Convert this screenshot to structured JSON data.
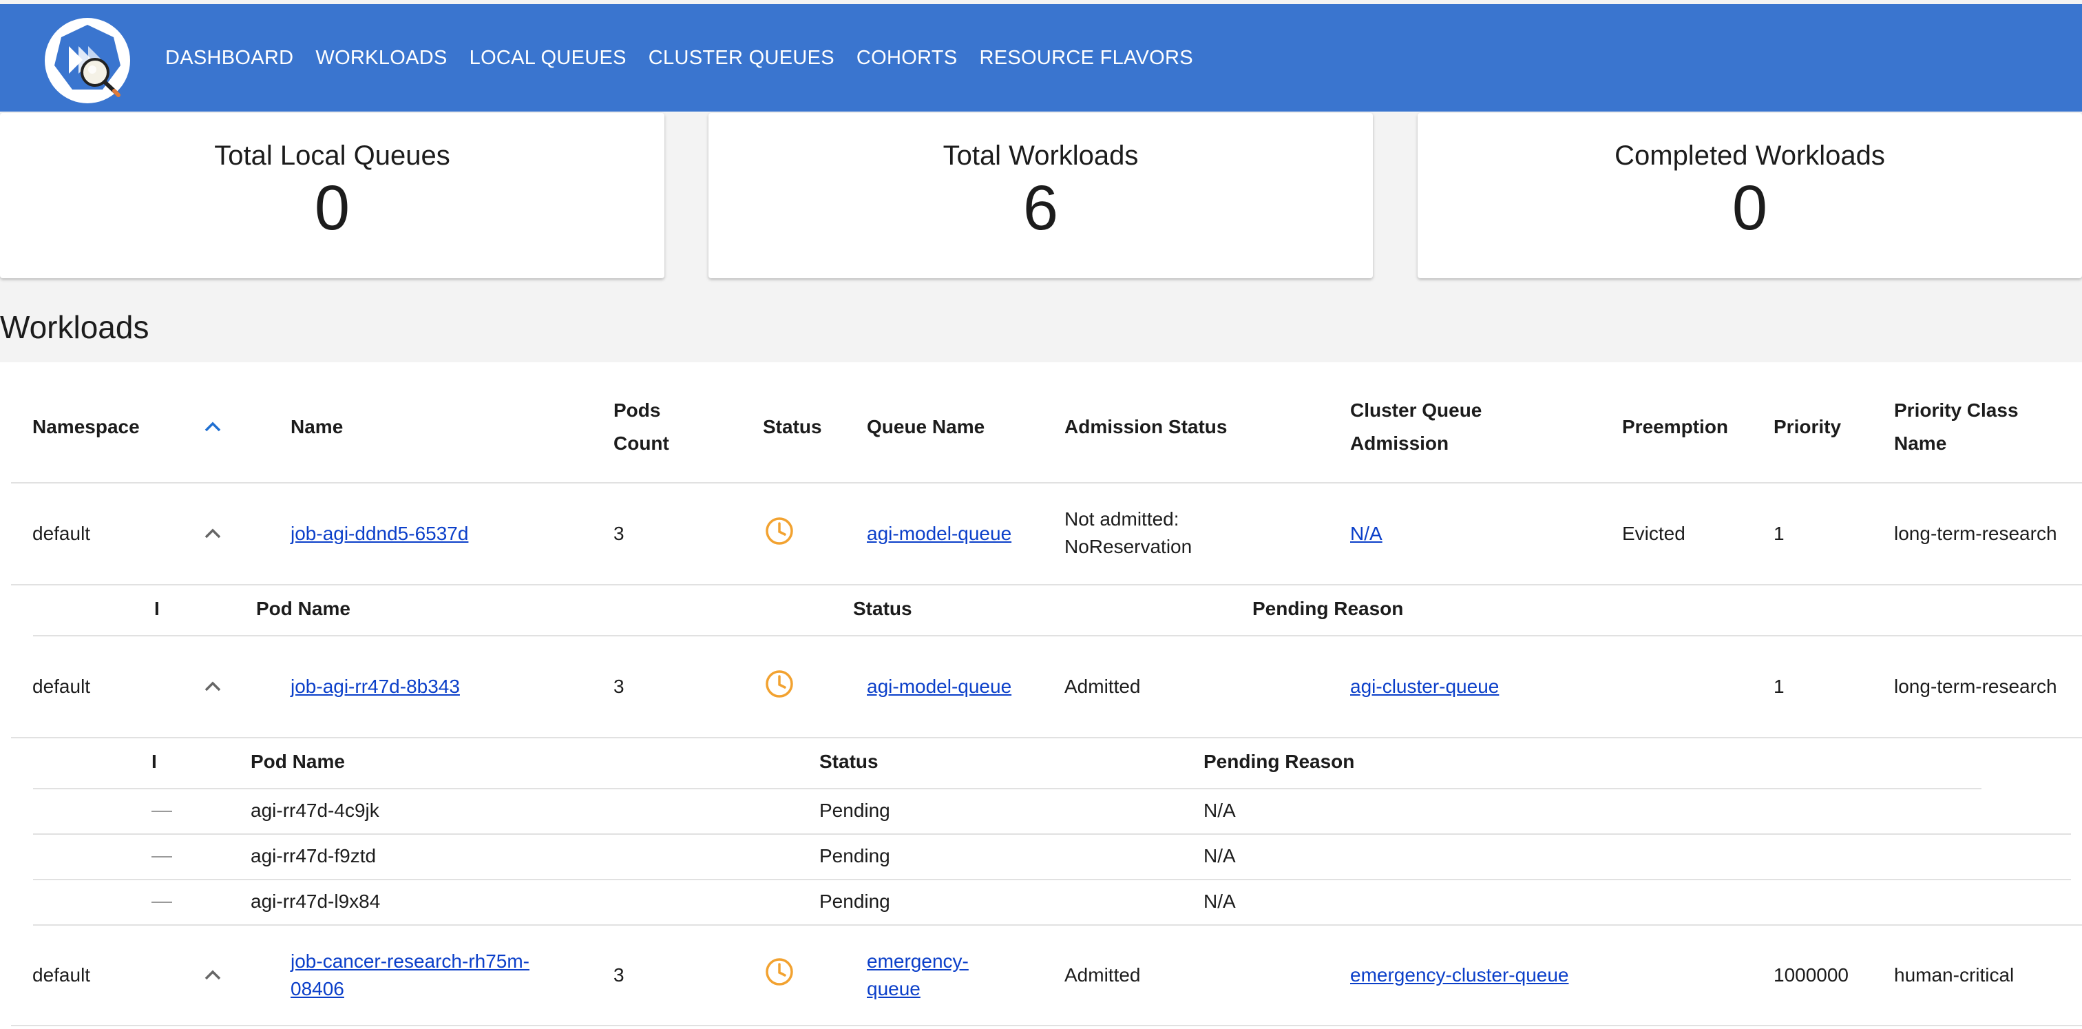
{
  "nav": {
    "items": [
      "DASHBOARD",
      "WORKLOADS",
      "LOCAL QUEUES",
      "CLUSTER QUEUES",
      "COHORTS",
      "RESOURCE FLAVORS"
    ]
  },
  "stats": [
    {
      "label": "Total Local Queues",
      "value": "0"
    },
    {
      "label": "Total Workloads",
      "value": "6"
    },
    {
      "label": "Completed Workloads",
      "value": "0"
    }
  ],
  "workloads": {
    "title": "Workloads",
    "columns": {
      "namespace": "Namespace",
      "name": "Name",
      "pods_count": "Pods Count",
      "status": "Status",
      "queue_name": "Queue Name",
      "admission_status": "Admission Status",
      "cluster_queue_admission": "Cluster Queue Admission",
      "preemption": "Preemption",
      "priority": "Priority",
      "priority_class_name": "Priority Class Name"
    },
    "sort_icon": "chevron-up-icon",
    "rows": [
      {
        "namespace": "default",
        "name": "job-agi-ddnd5-6537d",
        "pods_count": "3",
        "status_icon": "clock-icon",
        "queue_name": "agi-model-queue",
        "admission_status": "Not admitted: NoReservation",
        "cluster_queue_admission": "N/A",
        "preemption": "Evicted",
        "priority": "1",
        "priority_class_name": "long-term-research"
      },
      {
        "namespace": "default",
        "name": "job-agi-rr47d-8b343",
        "pods_count": "3",
        "status_icon": "clock-icon",
        "queue_name": "agi-model-queue",
        "admission_status": "Admitted",
        "cluster_queue_admission": "agi-cluster-queue",
        "preemption": "",
        "priority": "1",
        "priority_class_name": "long-term-research"
      },
      {
        "namespace": "default",
        "name": "job-cancer-research-rh75m-08406",
        "pods_count": "3",
        "status_icon": "clock-icon",
        "queue_name": "emergency-queue",
        "admission_status": "Admitted",
        "cluster_queue_admission": "emergency-cluster-queue",
        "preemption": "",
        "priority": "1000000",
        "priority_class_name": "human-critical"
      }
    ]
  },
  "pods_subtable": {
    "columns": {
      "indicator": "I",
      "pod_name": "Pod Name",
      "status": "Status",
      "pending_reason": "Pending Reason"
    },
    "pods": [
      {
        "name": "agi-rr47d-4c9jk",
        "status": "Pending",
        "reason": "N/A"
      },
      {
        "name": "agi-rr47d-f9ztd",
        "status": "Pending",
        "reason": "N/A"
      },
      {
        "name": "agi-rr47d-l9x84",
        "status": "Pending",
        "reason": "N/A"
      }
    ]
  },
  "colors": {
    "header": "#3a75cf",
    "accent": "#1f6fd1",
    "status_pending": "#f2a230",
    "link": "#0b3fc9"
  }
}
